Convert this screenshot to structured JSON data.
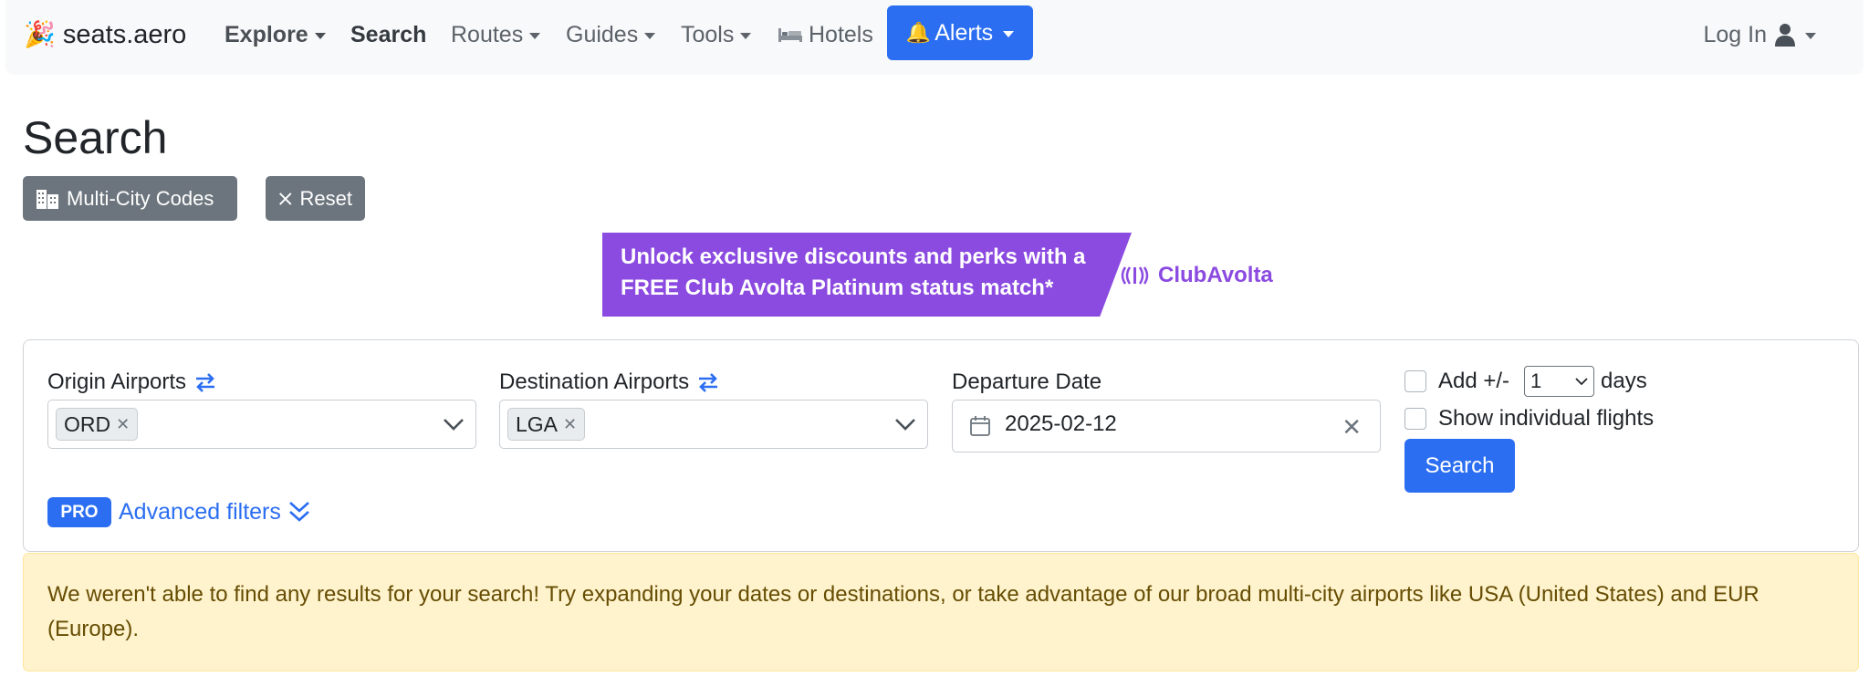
{
  "brand": {
    "name": "seats.aero",
    "icon": "party-popper-icon"
  },
  "nav": {
    "explore": "Explore",
    "search": "Search",
    "routes": "Routes",
    "guides": "Guides",
    "tools": "Tools",
    "hotels": "Hotels",
    "alerts": "Alerts",
    "login": "Log In"
  },
  "page": {
    "title": "Search"
  },
  "buttons": {
    "multi_city": "Multi-City Codes",
    "reset": "Reset"
  },
  "ad": {
    "text": "Unlock exclusive discounts and perks with a FREE Club Avolta Platinum status match*",
    "logo": "ClubAvolta"
  },
  "search_form": {
    "origin_label": "Origin Airports",
    "origin_value": "ORD",
    "destination_label": "Destination Airports",
    "destination_value": "LGA",
    "date_label": "Departure Date",
    "date_value": "2025-02-12",
    "add_label": "Add +/-",
    "days_value": "1",
    "days_label": "days",
    "individual_flights_label": "Show individual flights",
    "search_button": "Search",
    "pro_badge": "PRO",
    "advanced_filters": "Advanced filters"
  },
  "alert": {
    "message": "We weren't able to find any results for your search! Try expanding your dates or destinations, or take advantage of our broad multi-city airports like USA (United States) and EUR (Europe)."
  },
  "colors": {
    "primary": "#2b6ef2",
    "secondary": "#6c757d",
    "ad_purple": "#8b4ae0",
    "warning_bg": "#fff3cd"
  }
}
